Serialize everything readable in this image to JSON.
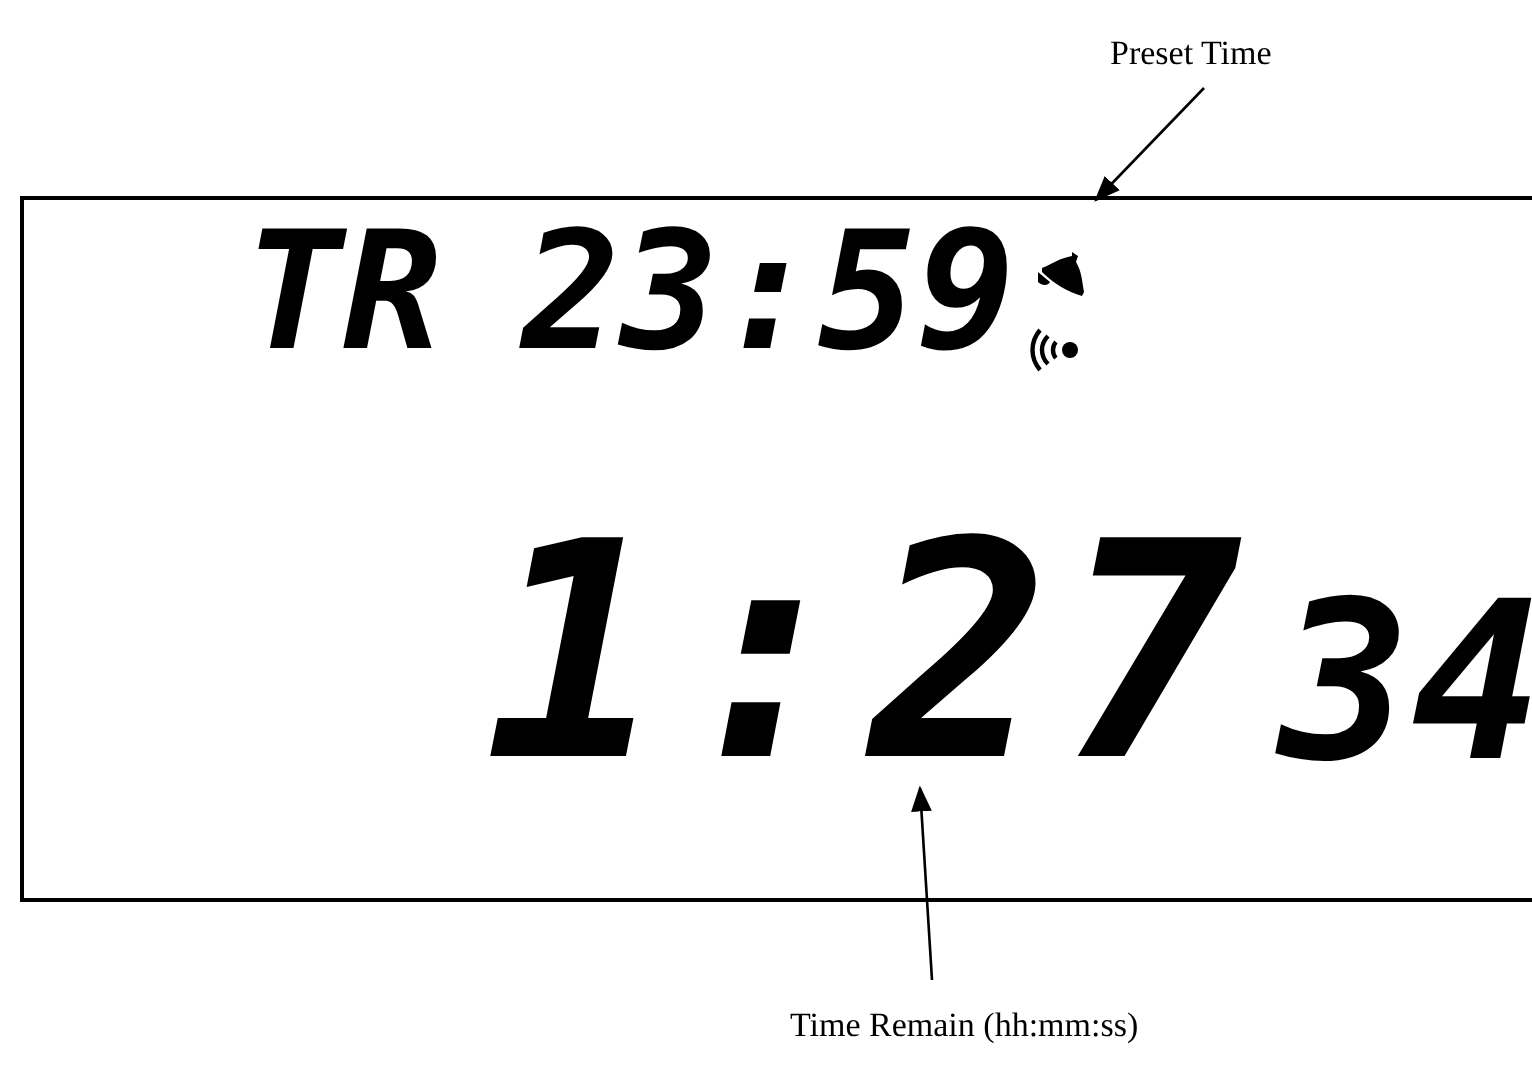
{
  "annotations": [
    {
      "kind": "top",
      "text": "Preset Time"
    },
    {
      "kind": "bottom",
      "text": "Time Remain (hh:mm:ss)"
    }
  ],
  "display": {
    "mode": "TR",
    "preset_time": "23:59",
    "alarm_on": true,
    "signal_on": true,
    "remaining_hm": "1:27",
    "remaining_seconds": "34"
  }
}
